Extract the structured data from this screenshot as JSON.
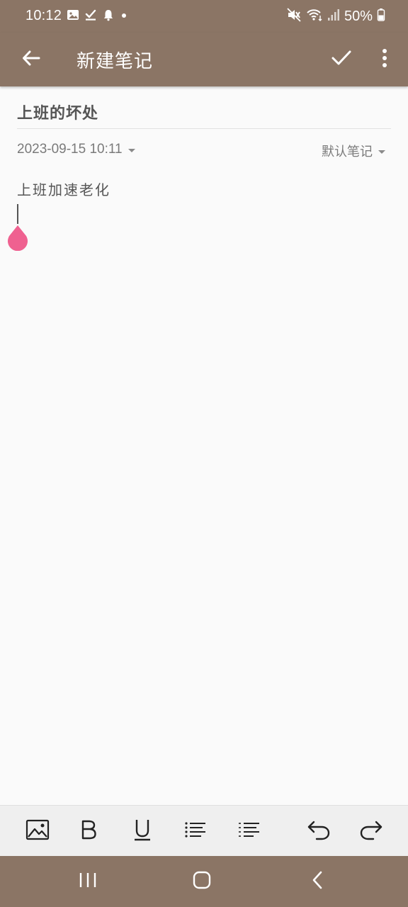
{
  "status_bar": {
    "time": "10:12",
    "battery": "50%",
    "left_icons": [
      "gallery-icon",
      "task-check-icon",
      "bell-icon",
      "dot-icon"
    ],
    "right_icons": [
      "mute-icon",
      "wifi-icon",
      "signal-icon",
      "battery-icon"
    ]
  },
  "app_bar": {
    "title": "新建笔记",
    "back_icon": "arrow-left-icon",
    "save_icon": "check-icon",
    "menu_icon": "more-vert-icon"
  },
  "note": {
    "title": "上班的坏处",
    "datetime": "2023-09-15 10:11",
    "notebook": "默认笔记",
    "body": "上班加速老化"
  },
  "toolbar": {
    "tools": [
      "insert-image-icon",
      "bold-icon",
      "underline-icon",
      "bullet-list-icon",
      "numbered-list-icon",
      "undo-icon",
      "redo-icon"
    ]
  },
  "navigation_bar": {
    "buttons": [
      "recent-apps-icon",
      "home-icon",
      "back-icon"
    ]
  },
  "colors": {
    "primary": "#8b7565",
    "background": "#fafafa",
    "text": "#555555",
    "accent_handle": "#ef6190",
    "toolbar_bg": "#efefef"
  }
}
